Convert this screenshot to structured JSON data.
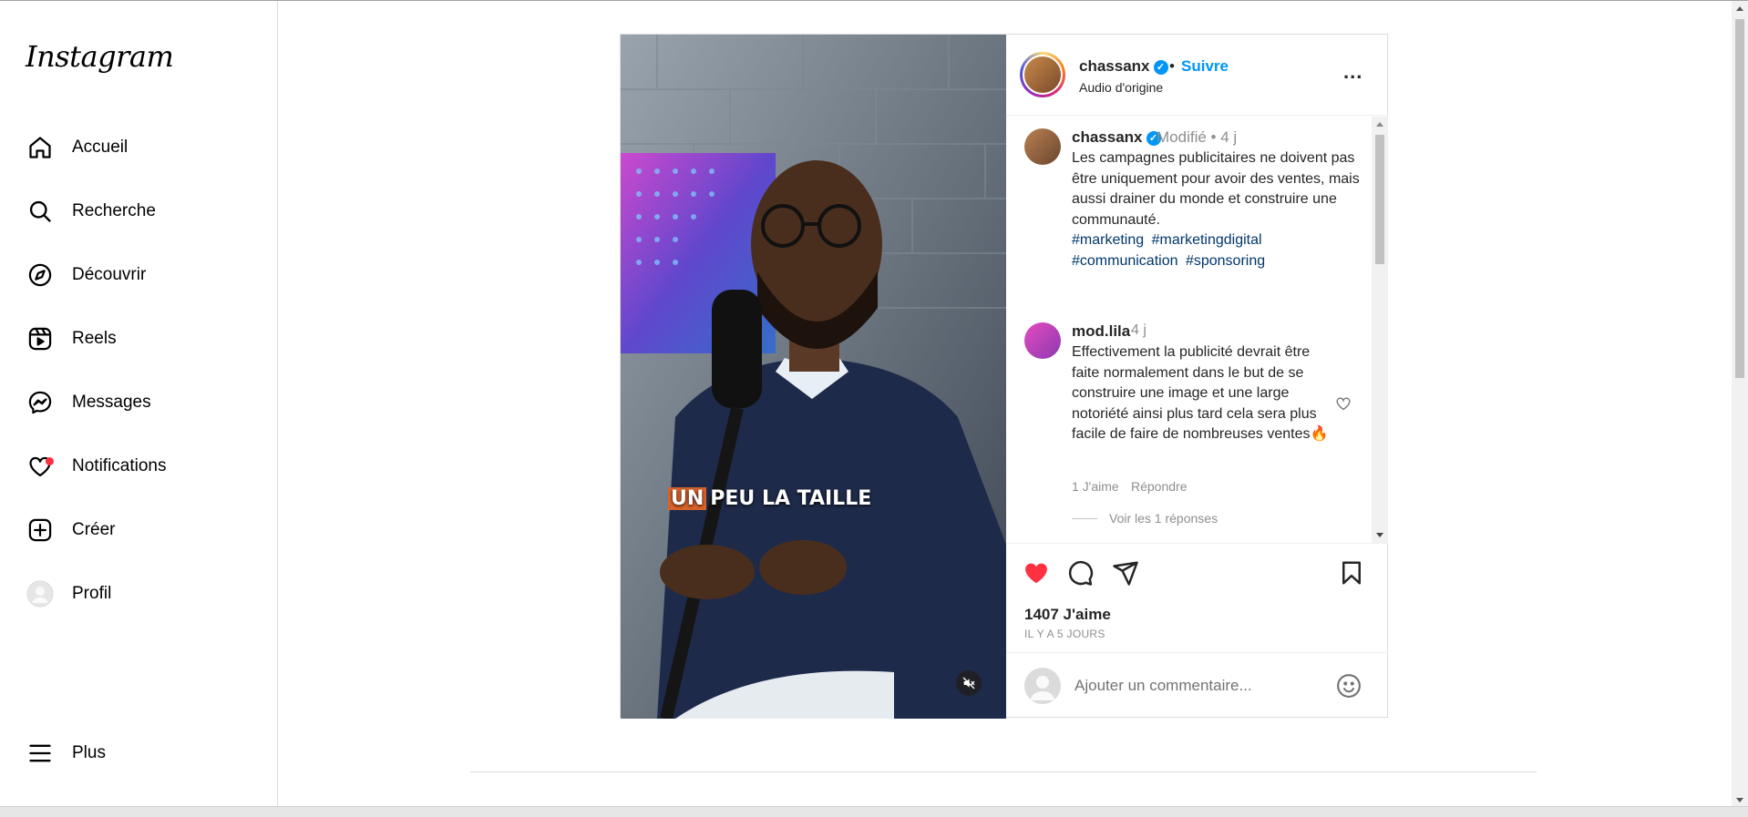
{
  "app": {
    "logo": "Instagram"
  },
  "sidebar": {
    "items": [
      {
        "label": "Accueil",
        "icon": "home-icon"
      },
      {
        "label": "Recherche",
        "icon": "search-icon"
      },
      {
        "label": "Découvrir",
        "icon": "compass-icon"
      },
      {
        "label": "Reels",
        "icon": "reels-icon"
      },
      {
        "label": "Messages",
        "icon": "messenger-icon"
      },
      {
        "label": "Notifications",
        "icon": "heart-icon"
      },
      {
        "label": "Créer",
        "icon": "plus-square-icon"
      },
      {
        "label": "Profil",
        "icon": "avatar"
      }
    ],
    "more_label": "Plus"
  },
  "post": {
    "video_caption_overlay": {
      "highlight": "UN",
      "rest": "PEU LA TAILLE"
    },
    "header": {
      "username": "chassanx",
      "separator": "•",
      "follow_label": "Suivre",
      "audio": "Audio d'origine",
      "more": "..."
    },
    "caption": {
      "username": "chassanx",
      "meta": "Modifié •  4 j",
      "text": "Les campagnes publicitaires ne doivent pas être uniquement pour avoir des ventes, mais aussi drainer du monde et construire une communauté.",
      "hashtags": [
        "#marketing",
        "#marketingdigital",
        "#communication",
        "#sponsoring"
      ]
    },
    "comments": [
      {
        "username": "mod.lila",
        "time": "4 j",
        "text": "Effectivement la publicité devrait être faite normalement dans le but de se construire une image et une large notoriété ainsi plus tard cela sera plus facile de faire de nombreuses ventes🔥",
        "likes": "1 J'aime",
        "reply_label": "Répondre",
        "view_replies": "Voir les 1 réponses"
      }
    ],
    "likes_count": "1407 J'aime",
    "time_ago": "IL Y A 5 JOURS",
    "add_comment": {
      "placeholder": "Ajouter un commentaire..."
    },
    "colors": {
      "like": "#ff3040",
      "link": "#0095f6",
      "hashtag": "#00376b"
    }
  }
}
